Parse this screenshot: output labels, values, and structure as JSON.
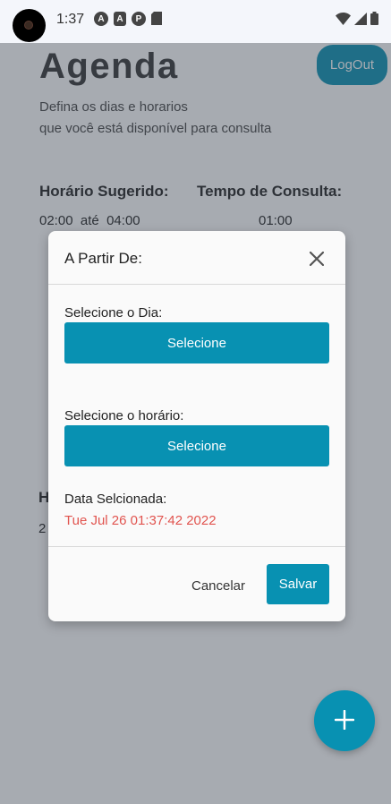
{
  "status_bar": {
    "time": "1:37",
    "notification_icons": [
      "A",
      "A",
      "P",
      "sd-card"
    ]
  },
  "page": {
    "title": "Agenda",
    "logout_label": "LogOut",
    "subtitle_line1": "Defina os dias e horarios",
    "subtitle_line2": "que você está disponível para consulta",
    "suggested_header": "Horário Sugerido:",
    "duration_header": "Tempo de Consulta:",
    "time_start": "02:00",
    "time_sep": "até",
    "time_end": "04:00",
    "duration_value": "01:00",
    "peek_heading": "H",
    "peek_value": "2"
  },
  "modal": {
    "title": "A Partir De:",
    "day_label": "Selecione o Dia:",
    "day_button": "Selecione",
    "time_label": "Selecione o horário:",
    "time_button": "Selecione",
    "date_label": "Data Selcionada:",
    "selected_date": "Tue Jul 26 01:37:42 2022",
    "cancel_label": "Cancelar",
    "save_label": "Salvar"
  },
  "colors": {
    "accent": "#0891b2",
    "date_text": "#e1544f",
    "overlay": "#3c4452"
  },
  "icons": {
    "close": "close-icon",
    "fab": "plus-icon"
  }
}
